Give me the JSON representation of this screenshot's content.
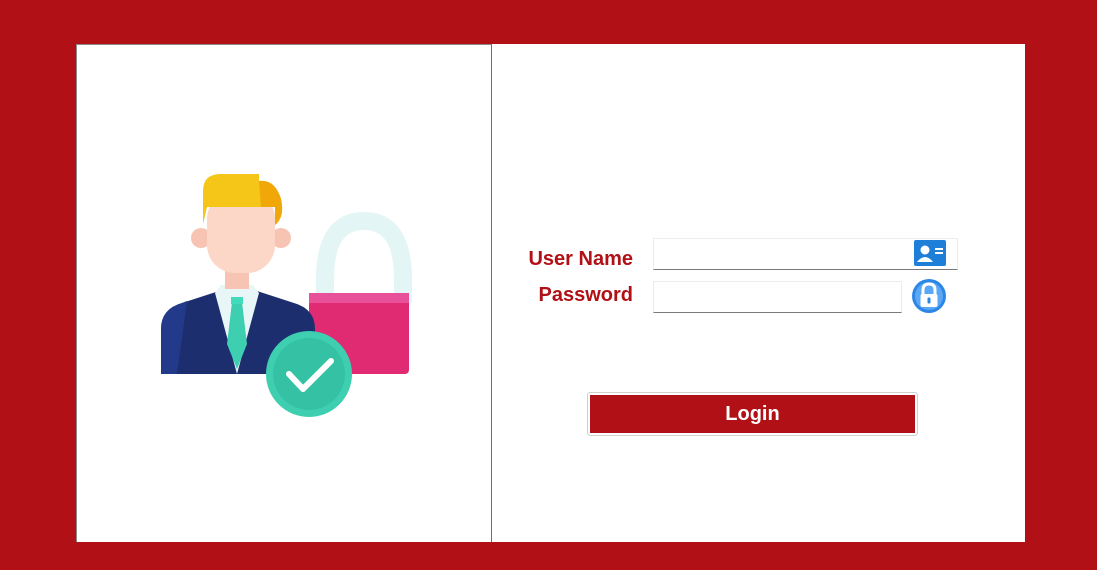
{
  "form": {
    "username_label": "User Name",
    "password_label": "Password",
    "username_value": "",
    "password_value": "",
    "login_label": "Login"
  },
  "icons": {
    "illustration": "user-unlocked-illustration",
    "username_icon": "contact-card-icon",
    "password_icon": "padlock-icon"
  },
  "colors": {
    "accent": "#b11116",
    "check_green": "#3ecfb0",
    "lock_pink": "#e02b73",
    "hair_yellow": "#f5c518"
  }
}
